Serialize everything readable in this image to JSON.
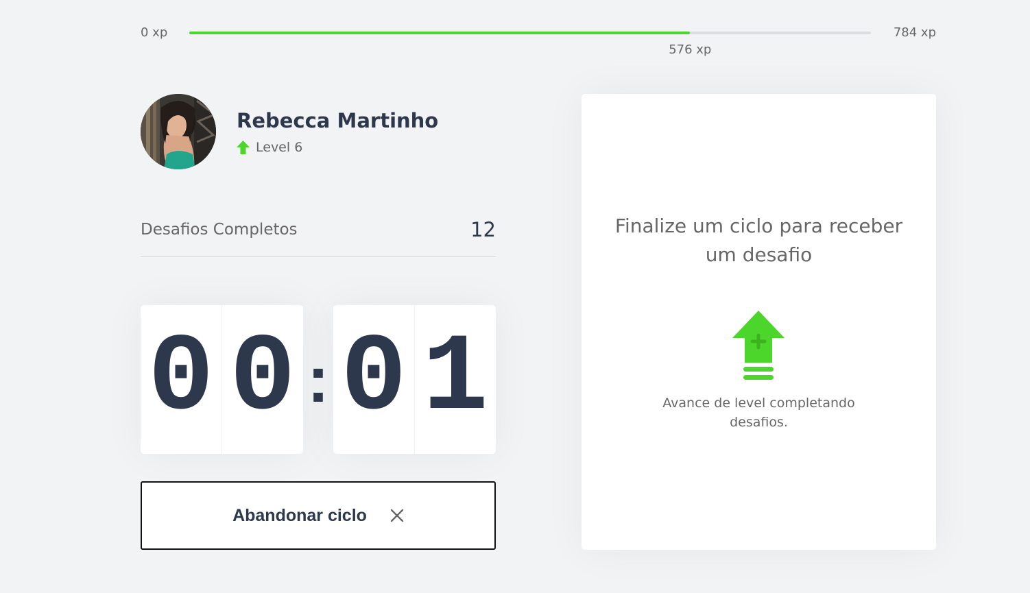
{
  "xp_bar": {
    "min_label": "0 xp",
    "max_label": "784 xp",
    "current_label": "576 xp",
    "current_xp": 576,
    "max_xp": 784,
    "fill_color": "#4cd62b"
  },
  "profile": {
    "name": "Rebecca Martinho",
    "level_label": "Level 6",
    "level_icon": "level-up-arrow-icon"
  },
  "completed_challenges": {
    "label": "Desafios Completos",
    "value": "12"
  },
  "countdown": {
    "minute_left": "0",
    "minute_right": "0",
    "separator": ":",
    "second_left": "0",
    "second_right": "1"
  },
  "abandon_button": {
    "label": "Abandonar ciclo",
    "icon": "close-icon"
  },
  "challenge_box": {
    "title": "Finalize um ciclo para receber um desafio",
    "icon": "level-up-icon",
    "description": "Avance de level completando desafios."
  },
  "colors": {
    "background": "#f2f3f5",
    "title": "#2e384d",
    "text": "#666666",
    "green": "#4cd62b",
    "white": "#ffffff"
  }
}
